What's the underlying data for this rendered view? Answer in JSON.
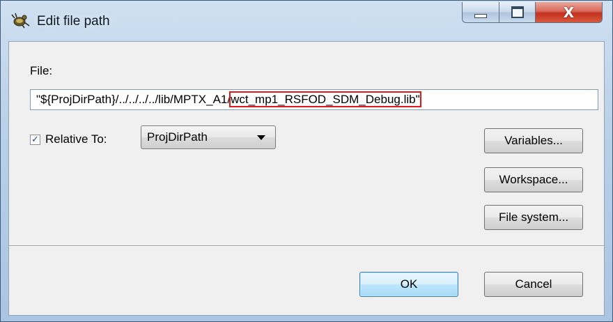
{
  "window": {
    "title": "Edit file path",
    "controls": {
      "minimize_icon": "minimize-icon",
      "maximize_icon": "maximize-icon",
      "close_glyph": "X"
    }
  },
  "form": {
    "file_label": "File:",
    "path_prefix": "\"${ProjDirPath}/../../../../lib/MPTX_A1/",
    "path_highlighted": "wct_mp1_RSFOD_SDM_Debug.lib\"",
    "relative_checked": true,
    "relative_label": "Relative To:",
    "relative_to_value": "ProjDirPath"
  },
  "buttons": {
    "variables": "Variables...",
    "workspace": "Workspace...",
    "file_system": "File system...",
    "ok": "OK",
    "cancel": "Cancel"
  },
  "colors": {
    "highlight_box": "#e01818",
    "default_button_border": "#3c7fb1"
  }
}
